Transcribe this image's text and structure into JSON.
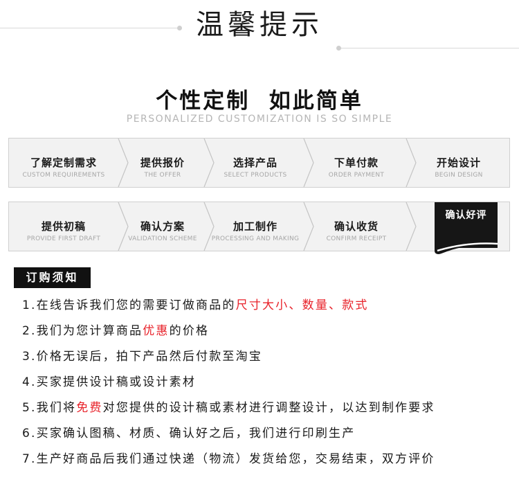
{
  "header": {
    "title": "温馨提示"
  },
  "section": {
    "title": "个性定制  如此简单",
    "subtitle": "PERSONALIZED CUSTOMIZATION IS SO SIMPLE"
  },
  "steps_row1": [
    {
      "title": "了解定制需求",
      "sub": "CUSTOM REQUIREMENTS"
    },
    {
      "title": "提供报价",
      "sub": "THE OFFER"
    },
    {
      "title": "选择产品",
      "sub": "SELECT PRODUCTS"
    },
    {
      "title": "下单付款",
      "sub": "ORDER PAYMENT"
    },
    {
      "title": "开始设计",
      "sub": "BEGIN DESIGN"
    }
  ],
  "steps_row2": [
    {
      "title": "提供初稿",
      "sub": "PROVIDE FIRST DRAFT"
    },
    {
      "title": "确认方案",
      "sub": "VALIDATION SCHEME"
    },
    {
      "title": "加工制作",
      "sub": "PROCESSING AND MAKING"
    },
    {
      "title": "确认收货",
      "sub": "CONFIRM RECEIPT"
    }
  ],
  "badge": {
    "text": "确认好评"
  },
  "notice": {
    "tag": "订购须知",
    "items": [
      {
        "pre": "1.在线告诉我们您的需要订做商品的",
        "red": "尺寸大小、数量、款式",
        "post": ""
      },
      {
        "pre": "2.我们为您计算商品",
        "red": "优惠",
        "post": "的价格"
      },
      {
        "pre": "3.价格无误后，拍下产品然后付款至淘宝",
        "red": "",
        "post": ""
      },
      {
        "pre": "4.买家提供设计稿或设计素材",
        "red": "",
        "post": ""
      },
      {
        "pre": "5.我们将",
        "red": "免费",
        "post": "对您提供的设计稿或素材进行调整设计，以达到制作要求"
      },
      {
        "pre": "6.买家确认图稿、材质、确认好之后，我们进行印刷生产",
        "red": "",
        "post": ""
      },
      {
        "pre": "7.生产好商品后我们通过快递（物流）发货给您，交易结束，双方评价",
        "red": "",
        "post": ""
      }
    ]
  },
  "colors": {
    "accent_red": "#e8222a",
    "dark": "#111111",
    "panel": "#f2f2f2"
  }
}
